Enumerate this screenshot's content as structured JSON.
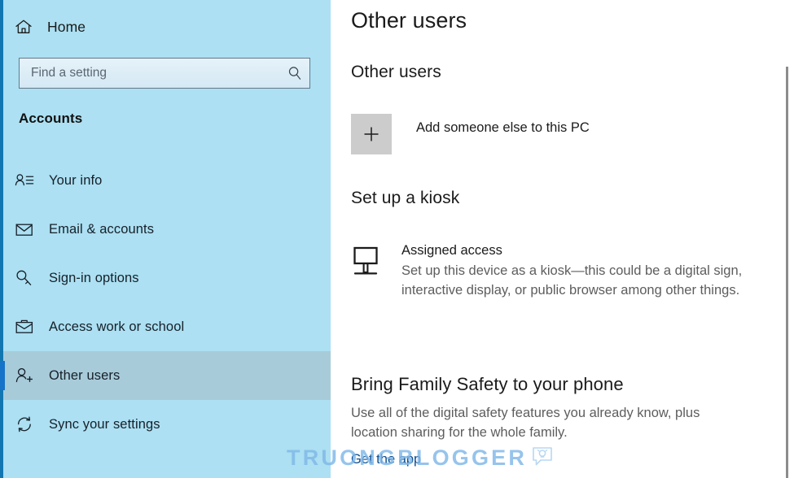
{
  "sidebar": {
    "home": {
      "label": "Home",
      "icon": "home-icon"
    },
    "search": {
      "value": "",
      "placeholder": "Find a setting",
      "icon": "search-icon"
    },
    "group_title": "Accounts",
    "items": [
      {
        "label": "Your info",
        "icon": "user-card-icon",
        "selected": false
      },
      {
        "label": "Email & accounts",
        "icon": "envelope-icon",
        "selected": false
      },
      {
        "label": "Sign-in options",
        "icon": "key-icon",
        "selected": false
      },
      {
        "label": "Access work or school",
        "icon": "briefcase-icon",
        "selected": false
      },
      {
        "label": "Other users",
        "icon": "add-user-icon",
        "selected": true
      },
      {
        "label": "Sync your settings",
        "icon": "sync-icon",
        "selected": false
      }
    ]
  },
  "content": {
    "page_title": "Other users",
    "other_users": {
      "heading": "Other users",
      "add_label": "Add someone else to this PC",
      "add_icon": "plus-icon"
    },
    "kiosk": {
      "heading": "Set up a kiosk",
      "icon": "kiosk-display-icon",
      "title": "Assigned access",
      "description": "Set up this device as a kiosk—this could be a digital sign, interactive display, or public browser among other things."
    },
    "family": {
      "heading": "Bring Family Safety to your phone",
      "description": "Use all of the digital safety features you already know, plus location sharing for the whole family.",
      "link_label": "Get the app"
    }
  },
  "watermark": {
    "text": "TRUONGBLOGGER",
    "icon": "lightbulb-bubble-icon"
  },
  "colors": {
    "sidebar_bg": "#ace0f2",
    "selected_row": "#a8cbd9",
    "accent_blue": "#1673c7",
    "edge_strip": "#1277b0",
    "link": "#0a4b8c",
    "tile_gray": "#cccccc",
    "muted_text": "#5d5d5d",
    "watermark": "#7fb8e8"
  }
}
